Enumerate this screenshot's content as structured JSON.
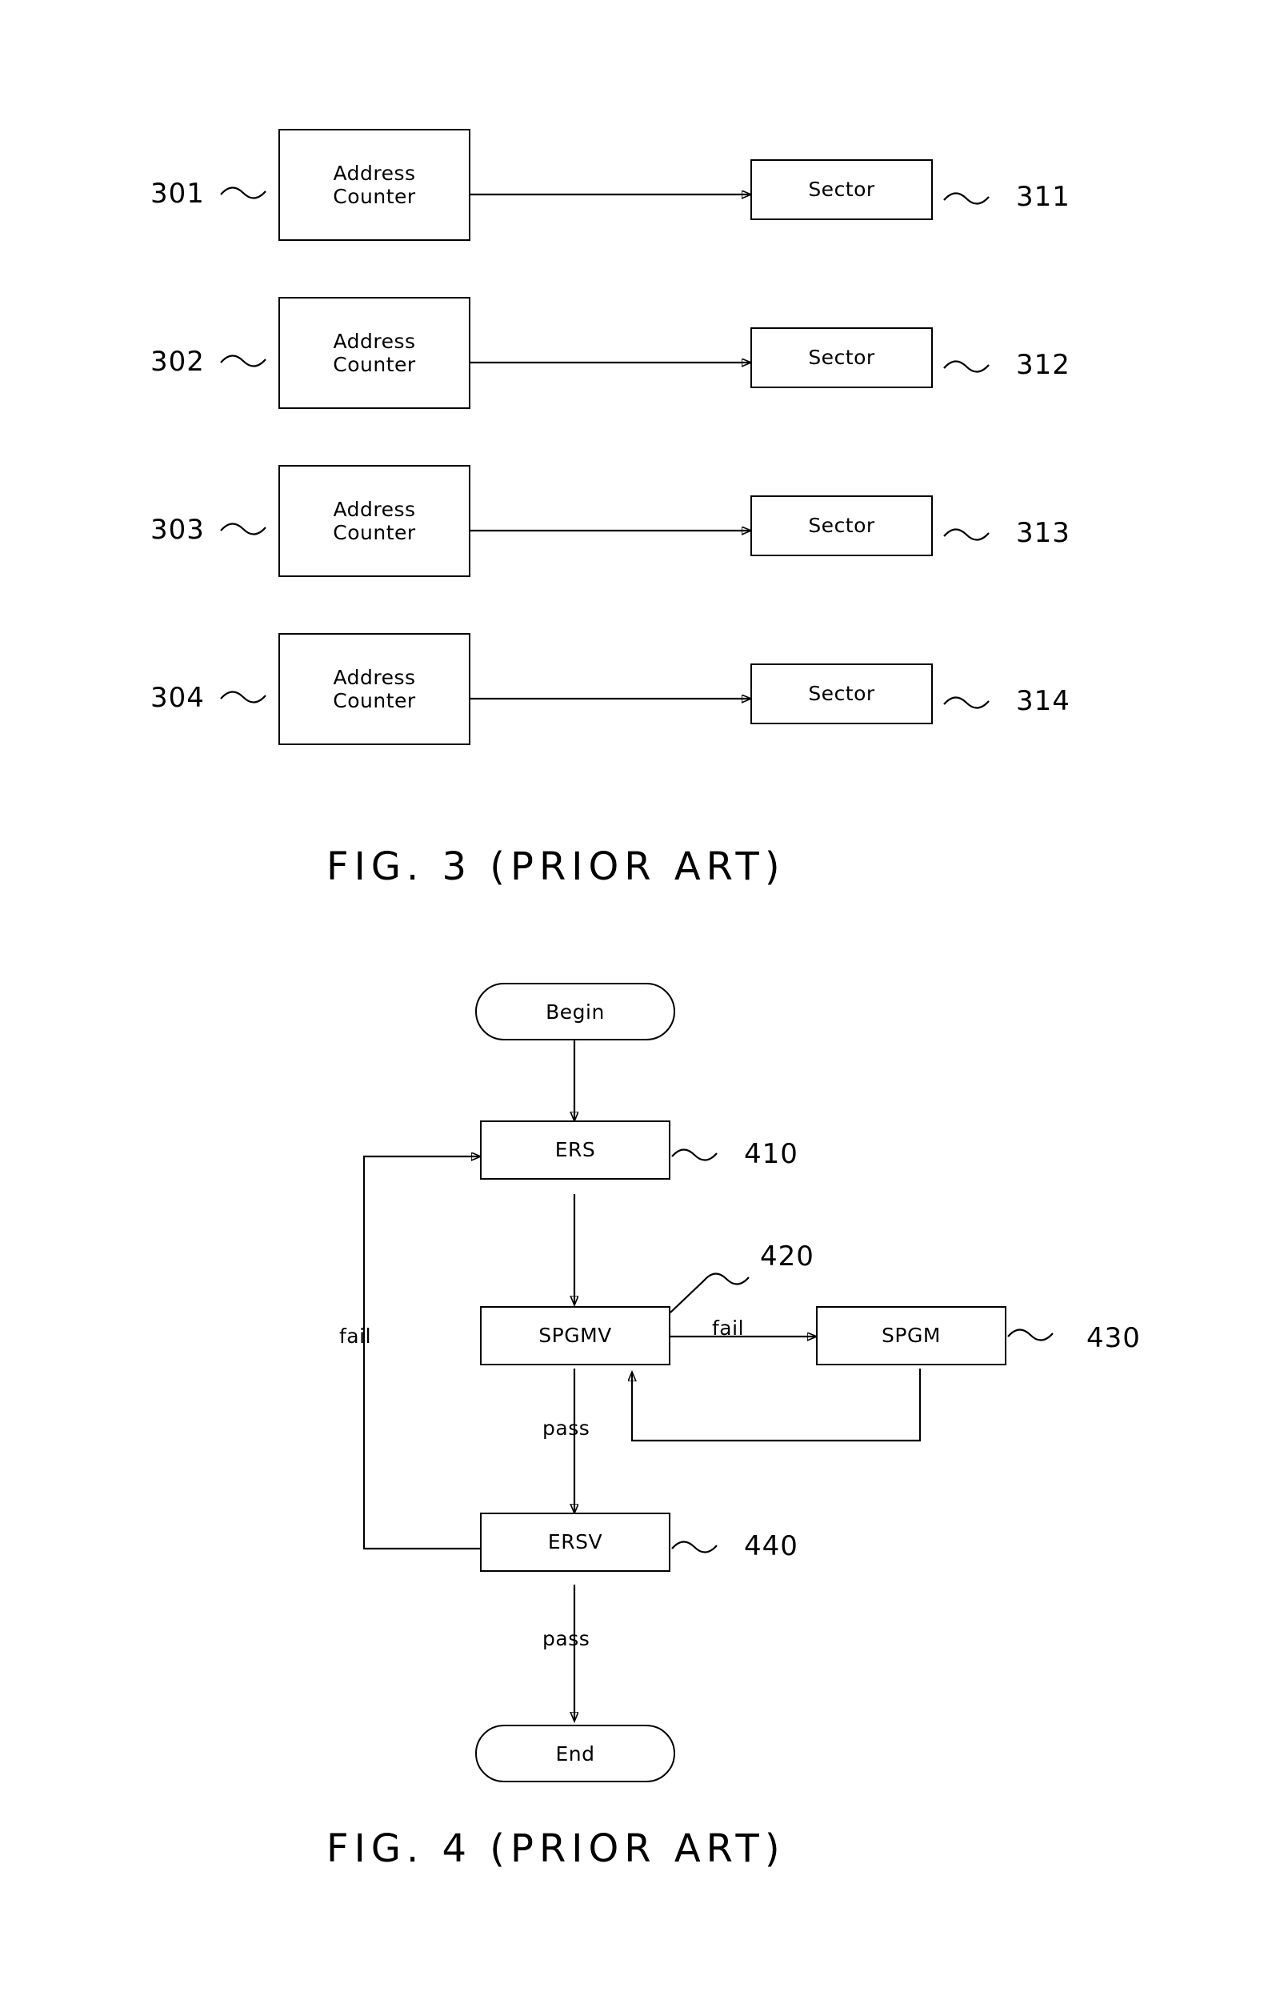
{
  "page": {
    "background": "#ffffff",
    "ink": "#000000"
  },
  "figures": [
    {
      "caption": "FIG. 3 (PRIOR ART)",
      "blocks": [
        {
          "label": "Address\nCounter",
          "line1": "Address",
          "line2": "Counter",
          "ref": "301"
        },
        {
          "label": "Address\nCounter",
          "line1": "Address",
          "line2": "Counter",
          "ref": "302"
        },
        {
          "label": "Address\nCounter",
          "line1": "Address",
          "line2": "Counter",
          "ref": "303"
        },
        {
          "label": "Address\nCounter",
          "line1": "Address",
          "line2": "Counter",
          "ref": "304"
        }
      ],
      "targets": [
        {
          "label": "Sector",
          "ref": "311"
        },
        {
          "label": "Sector",
          "ref": "312"
        },
        {
          "label": "Sector",
          "ref": "313"
        },
        {
          "label": "Sector",
          "ref": "314"
        }
      ]
    },
    {
      "caption": "FIG. 4 (PRIOR ART)",
      "nodes": {
        "begin": "Begin",
        "ers": "ERS",
        "spgmv": "SPGMV",
        "spgm": "SPGM",
        "ersv": "ERSV",
        "end": "End"
      },
      "refs": {
        "ers": "410",
        "spgmv": "420",
        "spgm": "430",
        "ersv": "440"
      },
      "edge_labels": {
        "fail_left": "fail",
        "fail_spgmv": "fail",
        "pass_spgmv": "pass",
        "pass_ersv": "pass"
      }
    }
  ],
  "fig3_labels": {
    "line1": "Address",
    "line2": "Counter",
    "sector": "Sector"
  }
}
